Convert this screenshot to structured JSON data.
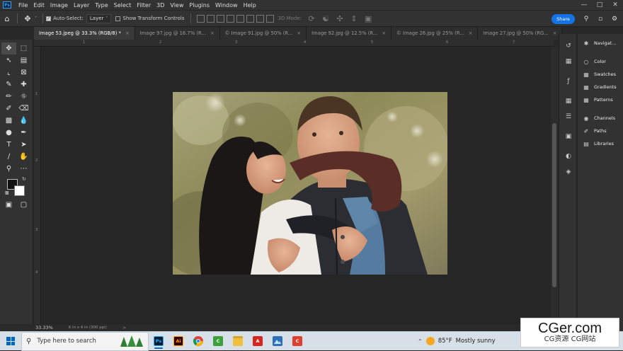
{
  "app": {
    "name": "Photoshop",
    "logo_text": "Ps"
  },
  "menubar": {
    "items": [
      "File",
      "Edit",
      "Image",
      "Layer",
      "Type",
      "Select",
      "Filter",
      "3D",
      "View",
      "Plugins",
      "Window",
      "Help"
    ],
    "window_controls": [
      "minimize",
      "maximize",
      "close"
    ]
  },
  "options": {
    "auto_select_label": "Auto-Select:",
    "auto_select_checked": true,
    "layer_select_value": "Layer",
    "show_transform_label": "Show Transform Controls",
    "show_transform_checked": false,
    "mode_3d_label": "3D Mode:",
    "share_label": "Share"
  },
  "tabs": [
    {
      "label": "Image 53.jpeg @ 33.3% (RGB/8) *",
      "active": true
    },
    {
      "label": "Image 97.jpg @ 16.7% (R...",
      "active": false
    },
    {
      "label": "© Image 91.jpg @ 50% (R...",
      "active": false
    },
    {
      "label": "Image 92.jpg @ 12.5% (R...",
      "active": false
    },
    {
      "label": "© Image 26.jpg @ 25% (R...",
      "active": false
    },
    {
      "label": "Image 27.jpg @ 50% (RG...",
      "active": false
    }
  ],
  "ruler": {
    "top_numbers": [
      "0",
      "1",
      "2",
      "3",
      "4",
      "5",
      "6",
      "7",
      "8",
      "9"
    ],
    "left_numbers": [
      "1",
      "2",
      "3",
      "4",
      "5"
    ]
  },
  "status": {
    "zoom": "33.33%",
    "doc_size": "6 in x 4 in (300 ppi)",
    "arrow": ">"
  },
  "panels": [
    {
      "label": "Navigat...",
      "icon": "navigator-icon"
    },
    {
      "label": "Color",
      "icon": "color-icon"
    },
    {
      "label": "Swatches",
      "icon": "swatches-icon"
    },
    {
      "label": "Gradients",
      "icon": "gradients-icon"
    },
    {
      "label": "Patterns",
      "icon": "patterns-icon"
    },
    {
      "label": "Channels",
      "icon": "channels-icon"
    },
    {
      "label": "Paths",
      "icon": "paths-icon"
    },
    {
      "label": "Libraries",
      "icon": "libraries-icon"
    }
  ],
  "taskbar": {
    "search_placeholder": "Type here to search",
    "weather_temp": "85°F",
    "weather_text": "Mostly sunny",
    "apps": [
      {
        "name": "photoshop",
        "label": "Ps",
        "bg": "#001e36",
        "fg": "#31a8ff"
      },
      {
        "name": "illustrator",
        "label": "Ai",
        "bg": "#330000",
        "fg": "#ff9a00"
      },
      {
        "name": "chrome",
        "label": "",
        "bg": "#ffffff",
        "fg": "#db4437"
      },
      {
        "name": "camtasia",
        "label": "C",
        "bg": "#3ba13b",
        "fg": "#ffffff"
      },
      {
        "name": "file-explorer",
        "label": "",
        "bg": "#f0c040",
        "fg": "#b07a00"
      },
      {
        "name": "acrobat",
        "label": "A",
        "bg": "#d4261f",
        "fg": "#ffffff"
      },
      {
        "name": "photos",
        "label": "",
        "bg": "#2f6fb8",
        "fg": "#ffffff"
      },
      {
        "name": "camtasia-recorder",
        "label": "C",
        "bg": "#e0402f",
        "fg": "#ffffff"
      }
    ]
  },
  "watermark": {
    "title": "CGer.com",
    "subtitle": "CG资源 CG网站"
  },
  "colors": {
    "accent": "#1473e6",
    "panel": "#323232",
    "canvas": "#262626"
  }
}
